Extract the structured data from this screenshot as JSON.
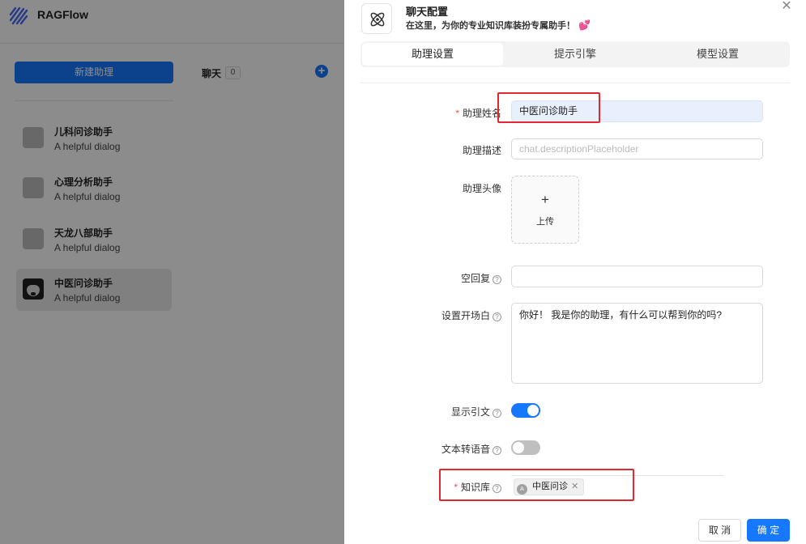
{
  "app": {
    "brand": "RAGFlow",
    "new_assistant_label": "新建助理",
    "chat_label": "聊天",
    "chat_count": "0",
    "assistants": [
      {
        "name": "儿科问诊助手",
        "description": "A helpful dialog",
        "active": false
      },
      {
        "name": "心理分析助手",
        "description": "A helpful dialog",
        "active": false
      },
      {
        "name": "天龙八部助手",
        "description": "A helpful dialog",
        "active": false
      },
      {
        "name": "中医问诊助手",
        "description": "A helpful dialog",
        "active": true
      }
    ]
  },
  "drawer": {
    "title": "聊天配置",
    "subtitle": "在这里，为你的专业知识库装扮专属助手！",
    "subtitle_emoji": "💕",
    "tabs": [
      {
        "label": "助理设置",
        "active": true
      },
      {
        "label": "提示引擎",
        "active": false
      },
      {
        "label": "模型设置",
        "active": false
      }
    ],
    "form": {
      "name_label": "助理姓名",
      "name_value": "中医问诊助手",
      "description_label": "助理描述",
      "description_placeholder": "chat.descriptionPlaceholder",
      "avatar_label": "助理头像",
      "upload_plus": "+",
      "upload_label": "上传",
      "empty_response_label": "空回复",
      "empty_response_value": "",
      "opener_label": "设置开场白",
      "opener_value": "你好！ 我是你的助理，有什么可以帮到你的吗?",
      "show_quote_label": "显示引文",
      "show_quote_on": true,
      "tts_label": "文本转语音",
      "tts_on": false,
      "knowledge_label": "知识库",
      "knowledge_tags": [
        {
          "avatar": "A",
          "name": "中医问诊"
        }
      ]
    },
    "footer": {
      "cancel_label": "取 消",
      "ok_label": "确 定"
    }
  },
  "colors": {
    "primary": "#1677ff",
    "required": "#ff4d4f",
    "highlight_box": "#e0282e"
  }
}
